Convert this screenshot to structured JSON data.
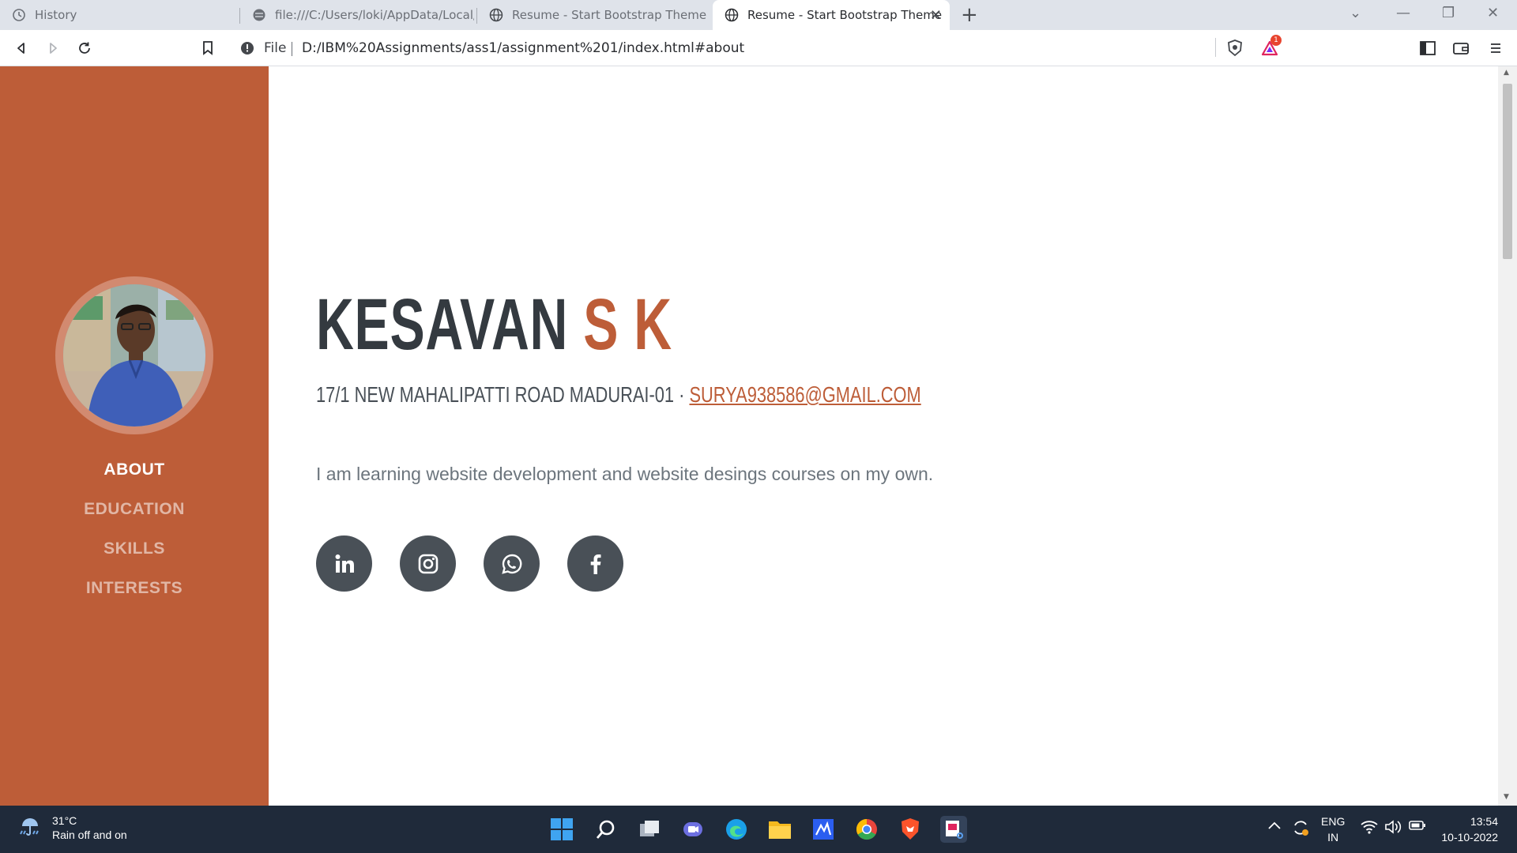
{
  "browser": {
    "tabs": [
      {
        "title": "History",
        "icon": "history-icon"
      },
      {
        "title": "file:///C:/Users/loki/AppData/Local/Mi",
        "icon": "globe-icon"
      },
      {
        "title": "Resume - Start Bootstrap Theme",
        "icon": "globe-icon"
      },
      {
        "title": "Resume - Start Bootstrap Theme",
        "icon": "globe-icon",
        "active": true
      }
    ],
    "address": {
      "scheme_label": "File",
      "url": "D:/IBM%20Assignments/ass1/assignment%201/index.html#about"
    },
    "rewards_badge": "1"
  },
  "sidebar": {
    "nav": [
      {
        "label": "ABOUT",
        "active": true
      },
      {
        "label": "EDUCATION"
      },
      {
        "label": "SKILLS"
      },
      {
        "label": "INTERESTS"
      }
    ]
  },
  "profile": {
    "first_name": "KESAVAN",
    "last_name": "S K",
    "address": "17/1 NEW MAHALIPATTI ROAD MADURAI-01 · ",
    "email": "SURYA938586@GMAIL.COM",
    "lead": "I am learning website development and website desings courses on my own.",
    "socials": [
      "linkedin-icon",
      "instagram-icon",
      "whatsapp-icon",
      "facebook-icon"
    ]
  },
  "taskbar": {
    "weather_temp": "31°C",
    "weather_desc": "Rain off and on",
    "lang_top": "ENG",
    "lang_bottom": "IN",
    "time": "13:54",
    "date": "10-10-2022"
  },
  "colors": {
    "accent": "#bd5d38",
    "dark": "#343a40",
    "taskbar": "#1f2a3a"
  }
}
